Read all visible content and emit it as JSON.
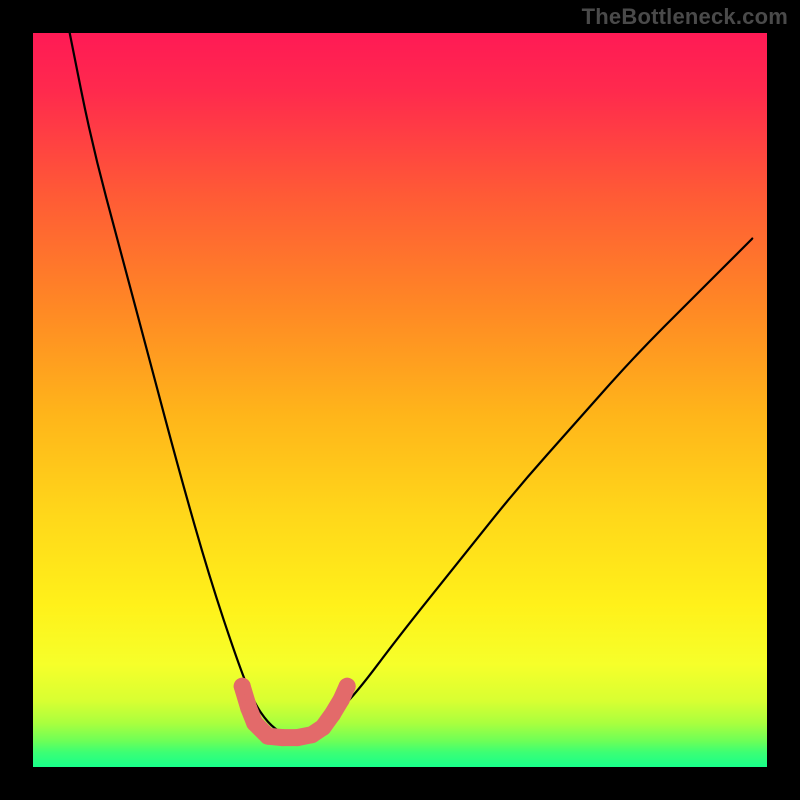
{
  "watermark": "TheBottleneck.com",
  "chart_data": {
    "type": "line",
    "title": "",
    "xlabel": "",
    "ylabel": "",
    "xlim": [
      0,
      100
    ],
    "ylim": [
      0,
      100
    ],
    "background_gradient": {
      "top": "#ff1a4d",
      "mid_upper": "#ff6a2a",
      "mid": "#ffd21a",
      "mid_lower": "#f6ff2a",
      "bottom_band": "#b6ff3a",
      "bottom": "#18ff8a"
    },
    "series": [
      {
        "name": "bottleneck-curve",
        "x": [
          5,
          8,
          12,
          16,
          20,
          24,
          28,
          30,
          32,
          34,
          36,
          38,
          40,
          44,
          50,
          58,
          66,
          74,
          82,
          90,
          98
        ],
        "y": [
          100,
          85,
          70,
          55,
          40,
          26,
          14,
          9,
          6,
          4.5,
          4,
          4.5,
          6,
          10,
          18,
          28,
          38,
          47,
          56,
          64,
          72
        ]
      }
    ],
    "valley_markers": {
      "name": "valley-dots",
      "color": "#e36a6a",
      "points": [
        {
          "x": 28.5,
          "y": 11
        },
        {
          "x": 29.4,
          "y": 8
        },
        {
          "x": 30.2,
          "y": 6
        },
        {
          "x": 32.0,
          "y": 4.2
        },
        {
          "x": 34.0,
          "y": 4.0
        },
        {
          "x": 36.0,
          "y": 4.0
        },
        {
          "x": 38.0,
          "y": 4.4
        },
        {
          "x": 39.5,
          "y": 5.4
        },
        {
          "x": 40.8,
          "y": 7.2
        },
        {
          "x": 42.0,
          "y": 9.2
        },
        {
          "x": 42.8,
          "y": 11.0
        }
      ]
    }
  }
}
